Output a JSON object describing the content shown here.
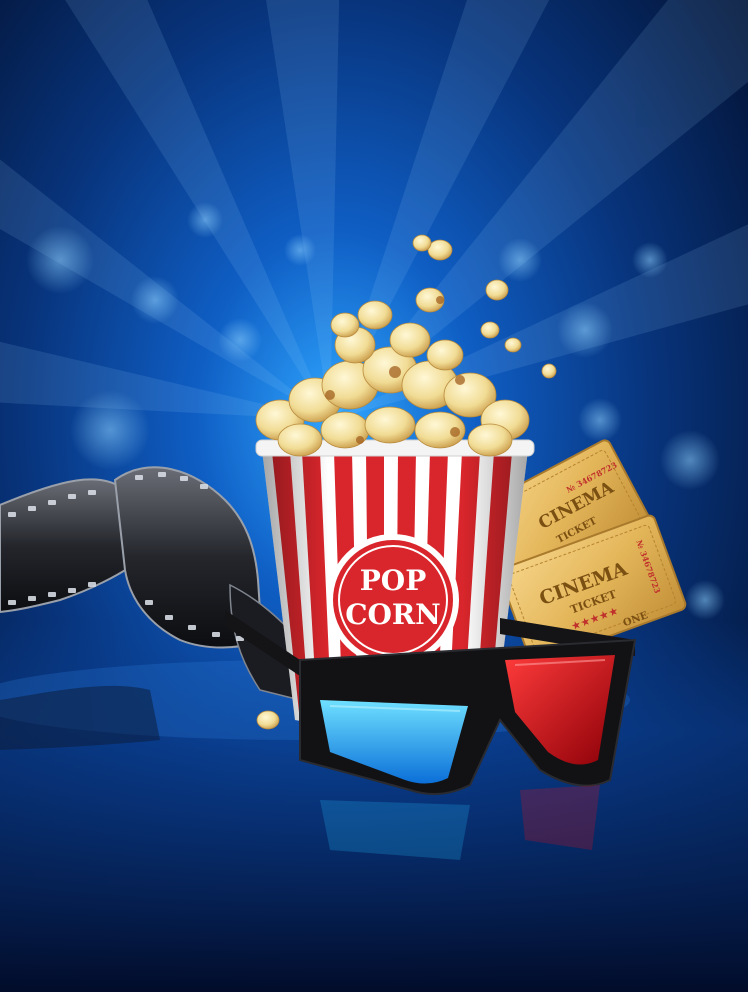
{
  "bucket": {
    "line1": "POP",
    "line2": "CORN"
  },
  "tickets": {
    "back": {
      "word": "CINEMA",
      "sub": "TICKET",
      "serial": "№ 34678723"
    },
    "front": {
      "word": "CINEMA",
      "sub": "TICKET",
      "serial": "№ 34678723",
      "admit": "ONE"
    }
  },
  "colors": {
    "background": "#0a3f8c",
    "stripe_red": "#d9262c",
    "ticket_gold": "#e4b65a",
    "lens_red": "#e0101a",
    "lens_blue": "#1fb0f0"
  }
}
